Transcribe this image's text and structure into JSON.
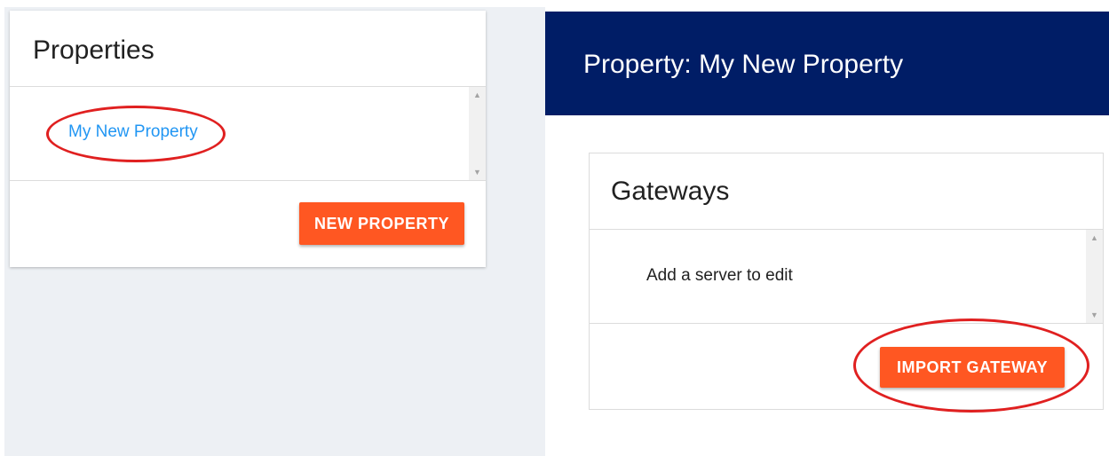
{
  "properties_card": {
    "title": "Properties",
    "items": [
      {
        "label": "My New Property"
      }
    ],
    "new_button_label": "NEW PROPERTY"
  },
  "property_panel": {
    "title": "Property: My New Property"
  },
  "gateways_card": {
    "title": "Gateways",
    "empty_text": "Add a server to edit",
    "import_button_label": "IMPORT GATEWAY"
  },
  "colors": {
    "header_bg": "#001d66",
    "accent_button": "#ff5722",
    "link": "#2196f3",
    "highlight_ring": "#e02020",
    "page_bg": "#edf0f4"
  },
  "icons": {
    "scroll_up": "triangle-up",
    "scroll_down": "triangle-down"
  }
}
